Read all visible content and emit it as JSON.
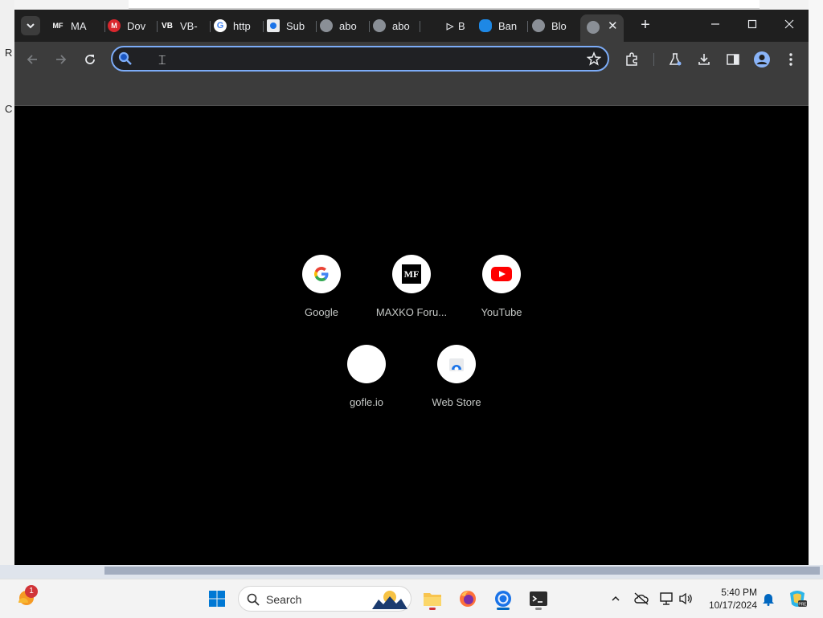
{
  "desktop": {
    "left_fragments": [
      "R",
      "C"
    ]
  },
  "tabs": [
    {
      "favicon_icon": "mf-icon",
      "title": "MA"
    },
    {
      "favicon_icon": "mega-icon",
      "title": "Dov"
    },
    {
      "favicon_icon": "vb-icon",
      "title": "VB-"
    },
    {
      "favicon_icon": "google-icon",
      "title": "http"
    },
    {
      "favicon_icon": "subtitle-icon",
      "title": "Sub"
    },
    {
      "favicon_icon": "globe-icon",
      "title": "abo"
    },
    {
      "favicon_icon": "globe-icon",
      "title": "abo"
    },
    {
      "favicon_icon": "play-icon",
      "title": "B"
    },
    {
      "favicon_icon": "banner-icon",
      "title": "Ban"
    },
    {
      "favicon_icon": "globe-icon",
      "title": "Blo"
    }
  ],
  "omnibox": {
    "value": "",
    "placeholder": ""
  },
  "shortcuts": [
    {
      "label": "Google",
      "icon": "google-icon"
    },
    {
      "label": "MAXKO Foru...",
      "icon": "mf-icon"
    },
    {
      "label": "YouTube",
      "icon": "youtube-icon"
    },
    {
      "label": "gofle.io",
      "icon": "blank-icon"
    },
    {
      "label": "Web Store",
      "icon": "web-store-icon"
    }
  ],
  "taskbar": {
    "search_label": "Search",
    "notification_count": "1",
    "time": "5:40 PM",
    "date": "10/17/2024"
  },
  "colors": {
    "tabstrip": "#1f1f1f",
    "toolbar": "#3c3c3c",
    "omnibox_border": "#7cacf8",
    "content_bg": "#000000",
    "youtube_red": "#ff0000"
  }
}
